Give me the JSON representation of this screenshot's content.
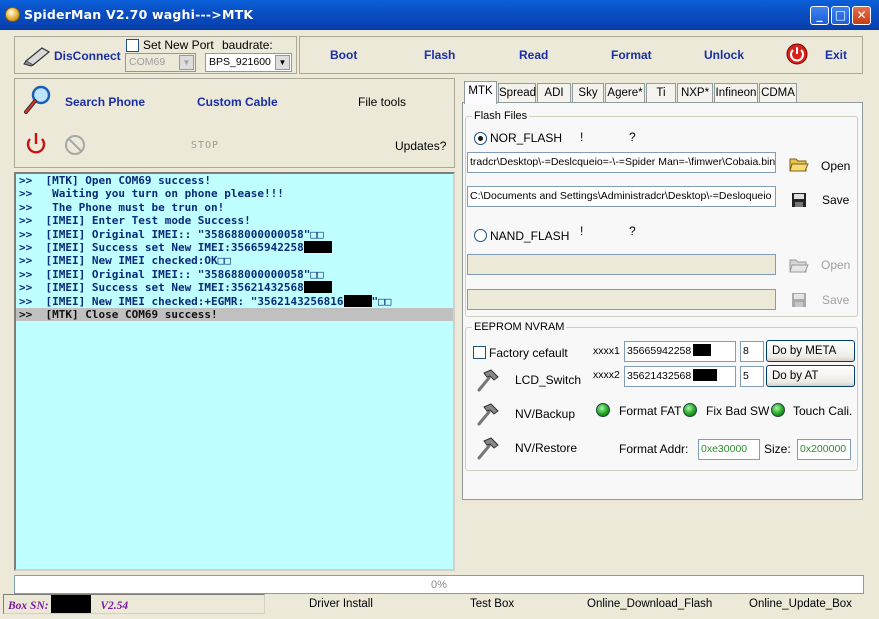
{
  "window": {
    "title": "SpiderMan V2.70 waghi--->MTK",
    "min": "_",
    "max": "□",
    "close": "✕"
  },
  "connect": {
    "disconnect_label": "DisConnect",
    "set_new_port_label": "Set New Port",
    "baudrate_label": "baudrate:",
    "port_value": "COM69",
    "baud_value": "BPS_921600"
  },
  "toolbar": {
    "boot": "Boot",
    "flash": "Flash",
    "read": "Read",
    "format": "Format",
    "unlock": "Unlock",
    "exit": "Exit"
  },
  "tools": {
    "search_phone": "Search Phone",
    "custom_cable": "Custom Cable",
    "file_tools": "File tools",
    "stop": "STOP",
    "updates": "Updates?"
  },
  "log": [
    {
      "text": ">>  [MTK] Open COM69 success!",
      "redact": false,
      "selected": false
    },
    {
      "text": ">>   Waiting you turn on phone please!!!",
      "redact": false,
      "selected": false
    },
    {
      "text": ">>   The Phone must be trun on!",
      "redact": false,
      "selected": false
    },
    {
      "text": ">>  [IMEI] Enter Test mode Success!",
      "redact": false,
      "selected": false
    },
    {
      "text": ">>  [IMEI] Original IMEI:: \"358688000000058\"□□",
      "redact": false,
      "selected": false
    },
    {
      "text": ">>  [IMEI] Success set New IMEI:35665942258",
      "redact": true,
      "selected": false
    },
    {
      "text": ">>  [IMEI] New IMEI checked:OK□□",
      "redact": false,
      "selected": false
    },
    {
      "text": ">>  [IMEI] Original IMEI:: \"358688000000058\"□□",
      "redact": false,
      "selected": false
    },
    {
      "text": ">>  [IMEI] Success set New IMEI:35621432568",
      "redact": true,
      "selected": false
    },
    {
      "text": ">>  [IMEI] New IMEI checked:+EGMR: \"3562143256816",
      "redact": true,
      "tail": "\"□□",
      "selected": false
    },
    {
      "text": ">>  [MTK] Close COM69 success!",
      "redact": false,
      "selected": true
    }
  ],
  "tabs": [
    "MTK",
    "Spread",
    "ADI",
    "Sky",
    "Agere*",
    "Ti",
    "NXP*",
    "Infineon",
    "CDMA"
  ],
  "flash_files": {
    "legend": "Flash Files",
    "nor_label": "NOR_FLASH",
    "nor_excl": "!",
    "nor_q": "?",
    "file1": "tradcr\\Desktop\\-=Deslcqueio=-\\-=Spider Man=-\\fimwer\\Cobaia.bin",
    "file2": "C:\\Documents and Settings\\Administradcr\\Desktop\\-=Desloqueio",
    "open": "Open",
    "save": "Save",
    "nand_label": "NAND_FLASH",
    "nand_excl": "!",
    "nand_q": "?",
    "open2": "Open",
    "save2": "Save"
  },
  "eeprom": {
    "legend": "EEPROM NVRAM",
    "factory_default": "Factory cefault",
    "xxxx1_label": "xxxx1",
    "xxxx1_value": "35665942258",
    "xxxx1_num": "8",
    "do_by_meta": "Do by META",
    "lcd_switch": "LCD_Switch",
    "xxxx2_label": "xxxx2",
    "xxxx2_value": "35621432568",
    "xxxx2_num": "5",
    "do_by_at": "Do by AT",
    "nv_backup": "NV/Backup",
    "format_fat": "Format FAT",
    "fix_bad_sw": "Fix Bad SW",
    "touch_cali": "Touch Cali.",
    "nv_restore": "NV/Restore",
    "format_addr_label": "Format Addr:",
    "format_addr_value": "0xe30000",
    "size_label": "Size:",
    "size_value": "0x200000"
  },
  "progress": {
    "text": "0%"
  },
  "status": {
    "box_sn_label": "Box SN:",
    "version": "V2.54",
    "driver_install": "Driver Install",
    "test_box": "Test Box",
    "online_download_flash": "Online_Download_Flash",
    "online_update_box": "Online_Update_Box"
  }
}
